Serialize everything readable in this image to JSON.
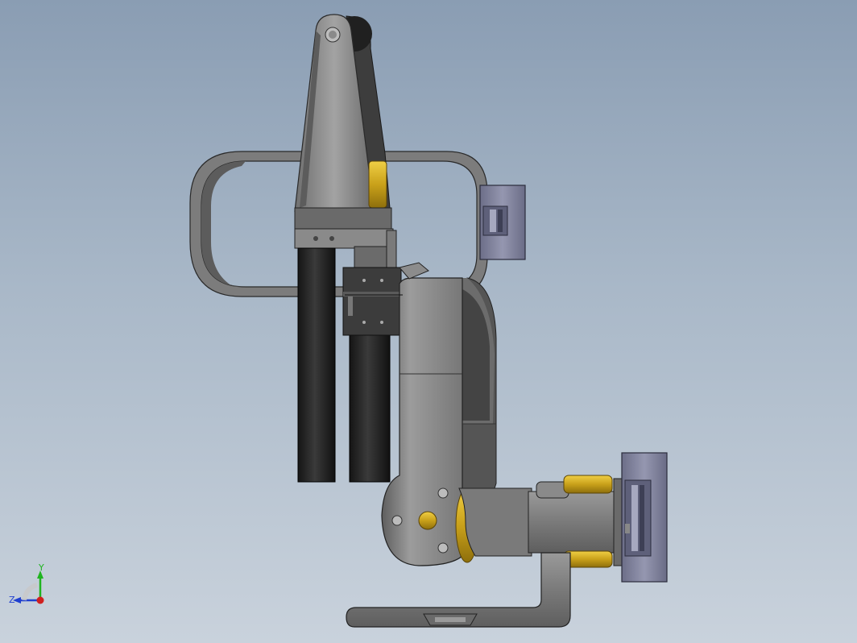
{
  "triad": {
    "y_label": "Y",
    "z_label": "Z",
    "colors": {
      "y": "#1fb41f",
      "z": "#1f3fd0",
      "origin": "#d01f1f"
    }
  },
  "colors": {
    "background_top": "#8a9db3",
    "background_bottom": "#c9d2dc",
    "metal": "#8e8e8e",
    "metal_dark": "#5a5a5a",
    "brass": "#d7b020",
    "rod": "#1e1e1e",
    "block": "#7d7f9a"
  }
}
